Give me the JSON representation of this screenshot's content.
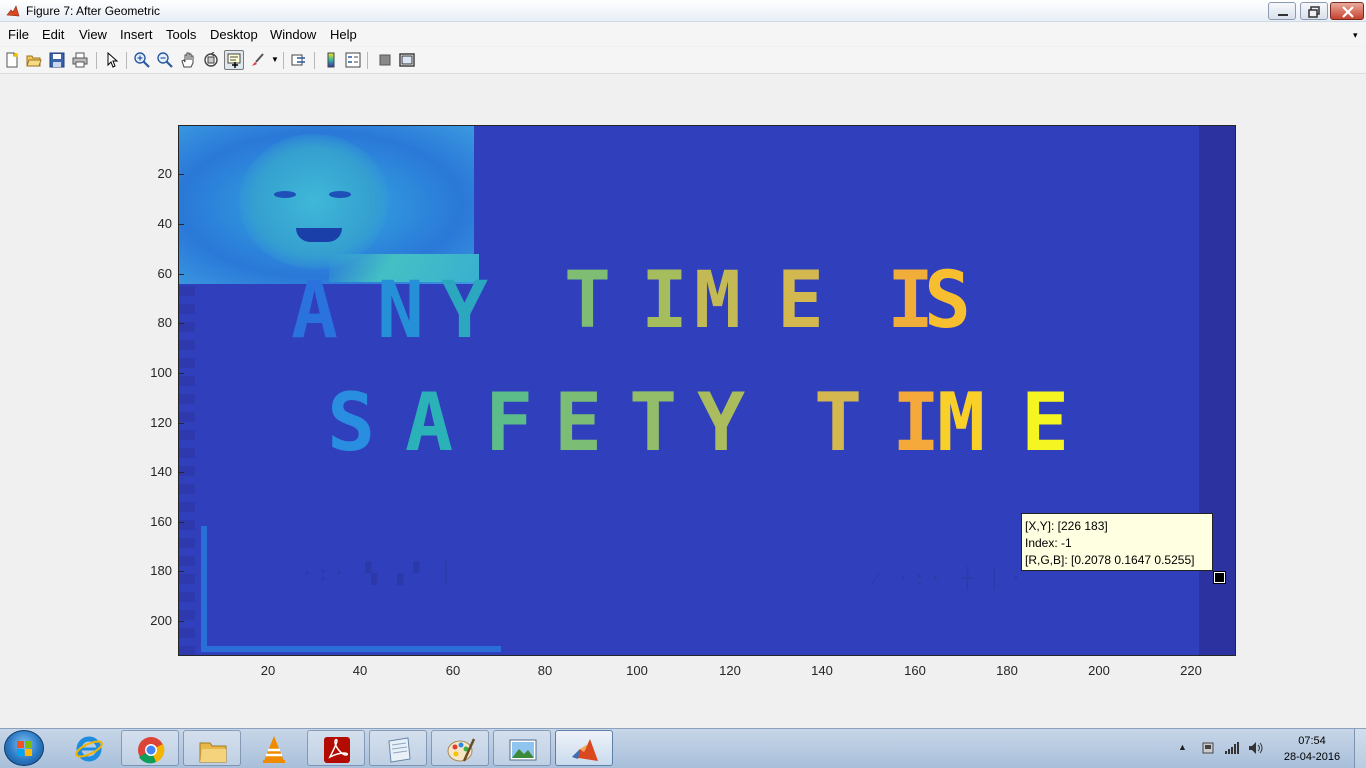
{
  "window": {
    "title": "Figure 7: After Geometric",
    "icon": "matlab-figure-icon",
    "controls": [
      "minimize-icon",
      "maximize-icon",
      "close-icon"
    ]
  },
  "menubar": {
    "items": [
      "File",
      "Edit",
      "View",
      "Insert",
      "Tools",
      "Desktop",
      "Window",
      "Help"
    ]
  },
  "toolbar": {
    "buttons": [
      "new-figure-icon",
      "open-file-icon",
      "save-icon",
      "print-icon",
      "edit-plot-icon",
      "zoom-in-icon",
      "zoom-out-icon",
      "pan-icon",
      "rotate-3d-icon",
      "data-cursor-icon",
      "brush-icon",
      "link-plot-icon",
      "colorbar-icon",
      "legend-icon",
      "hide-plot-tools-icon",
      "show-plot-tools-icon"
    ],
    "pressed": "data-cursor-icon"
  },
  "axes": {
    "yticks": [
      "20",
      "40",
      "60",
      "80",
      "100",
      "120",
      "140",
      "160",
      "180",
      "200"
    ],
    "xticks": [
      "20",
      "40",
      "60",
      "80",
      "100",
      "120",
      "140",
      "160",
      "180",
      "200",
      "220"
    ],
    "image_text_line1": "ANY TIME IS",
    "image_text_line2": "SAFETY TIME",
    "background_color": "#3040bc"
  },
  "datatip": {
    "xy": "[X,Y]: [226 183]",
    "index": "Index: -1",
    "rgb": "[R,G,B]: [0.2078 0.1647 0.5255]"
  },
  "taskbar": {
    "start": "windows-start-icon",
    "apps": [
      "internet-explorer-icon",
      "chrome-icon",
      "file-explorer-icon",
      "vlc-icon",
      "acrobat-reader-icon",
      "notepad-icon",
      "paint-icon",
      "photo-viewer-icon",
      "matlab-icon"
    ],
    "active_app": "matlab-icon",
    "tray": [
      "show-hidden-icons-arrow",
      "usb-device-icon",
      "network-icon",
      "volume-icon"
    ],
    "time": "07:54",
    "date": "28-04-2016"
  }
}
